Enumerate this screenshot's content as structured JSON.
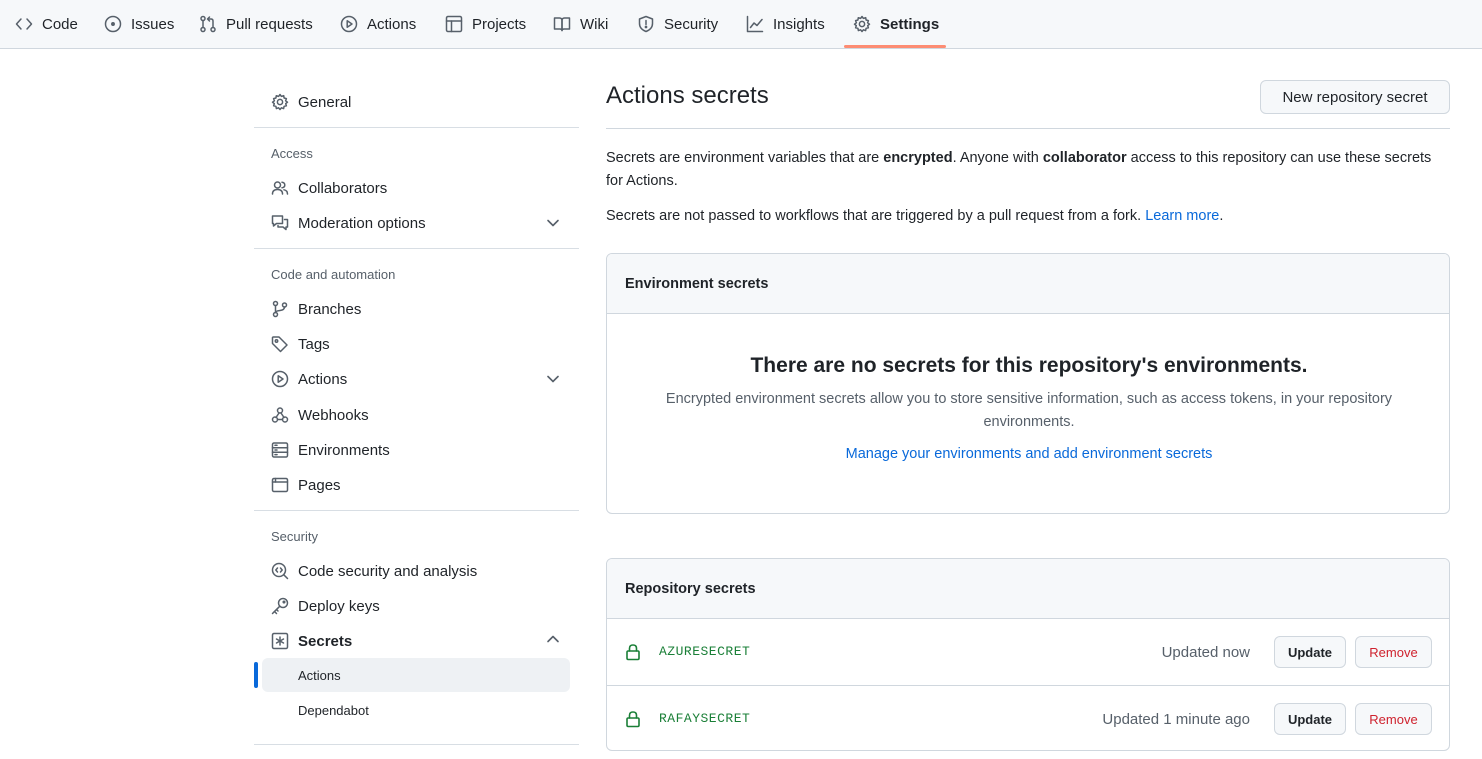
{
  "nav": {
    "tabs": [
      {
        "label": "Code",
        "icon": "code-icon"
      },
      {
        "label": "Issues",
        "icon": "issue-icon"
      },
      {
        "label": "Pull requests",
        "icon": "pull-request-icon"
      },
      {
        "label": "Actions",
        "icon": "play-icon"
      },
      {
        "label": "Projects",
        "icon": "table-icon"
      },
      {
        "label": "Wiki",
        "icon": "book-icon"
      },
      {
        "label": "Security",
        "icon": "shield-icon"
      },
      {
        "label": "Insights",
        "icon": "graph-icon"
      },
      {
        "label": "Settings",
        "icon": "gear-icon",
        "active": true
      }
    ],
    "accent": "#fd8c73"
  },
  "sidebar": {
    "general": "General",
    "access_heading": "Access",
    "collaborators": "Collaborators",
    "moderation": "Moderation options",
    "code_heading": "Code and automation",
    "branches": "Branches",
    "tags": "Tags",
    "actions": "Actions",
    "webhooks": "Webhooks",
    "environments": "Environments",
    "pages": "Pages",
    "security_heading": "Security",
    "code_security": "Code security and analysis",
    "deploy_keys": "Deploy keys",
    "secrets": "Secrets",
    "secrets_actions": "Actions",
    "secrets_dependabot": "Dependabot"
  },
  "main": {
    "title": "Actions secrets",
    "new_button": "New repository secret",
    "desc1_a": "Secrets are environment variables that are ",
    "desc1_b": "encrypted",
    "desc1_c": ". Anyone with ",
    "desc1_d": "collaborator",
    "desc1_e": " access to this repository can use these secrets for Actions.",
    "desc2": "Secrets are not passed to workflows that are triggered by a pull request from a fork. ",
    "learn_more": "Learn more",
    "env": {
      "heading": "Environment secrets",
      "empty_title": "There are no secrets for this repository's environments.",
      "empty_text": "Encrypted environment secrets allow you to store sensitive information, such as access tokens, in your repository environments.",
      "manage_link": "Manage your environments and add environment secrets"
    },
    "repo": {
      "heading": "Repository secrets",
      "update_label": "Update",
      "remove_label": "Remove",
      "secrets": [
        {
          "name": "AZURESECRET",
          "updated": "Updated now"
        },
        {
          "name": "RAFAYSECRET",
          "updated": "Updated 1 minute ago"
        }
      ]
    }
  },
  "colors": {
    "link": "#0969da",
    "secret_green": "#1a7f37",
    "danger": "#cf222e"
  }
}
